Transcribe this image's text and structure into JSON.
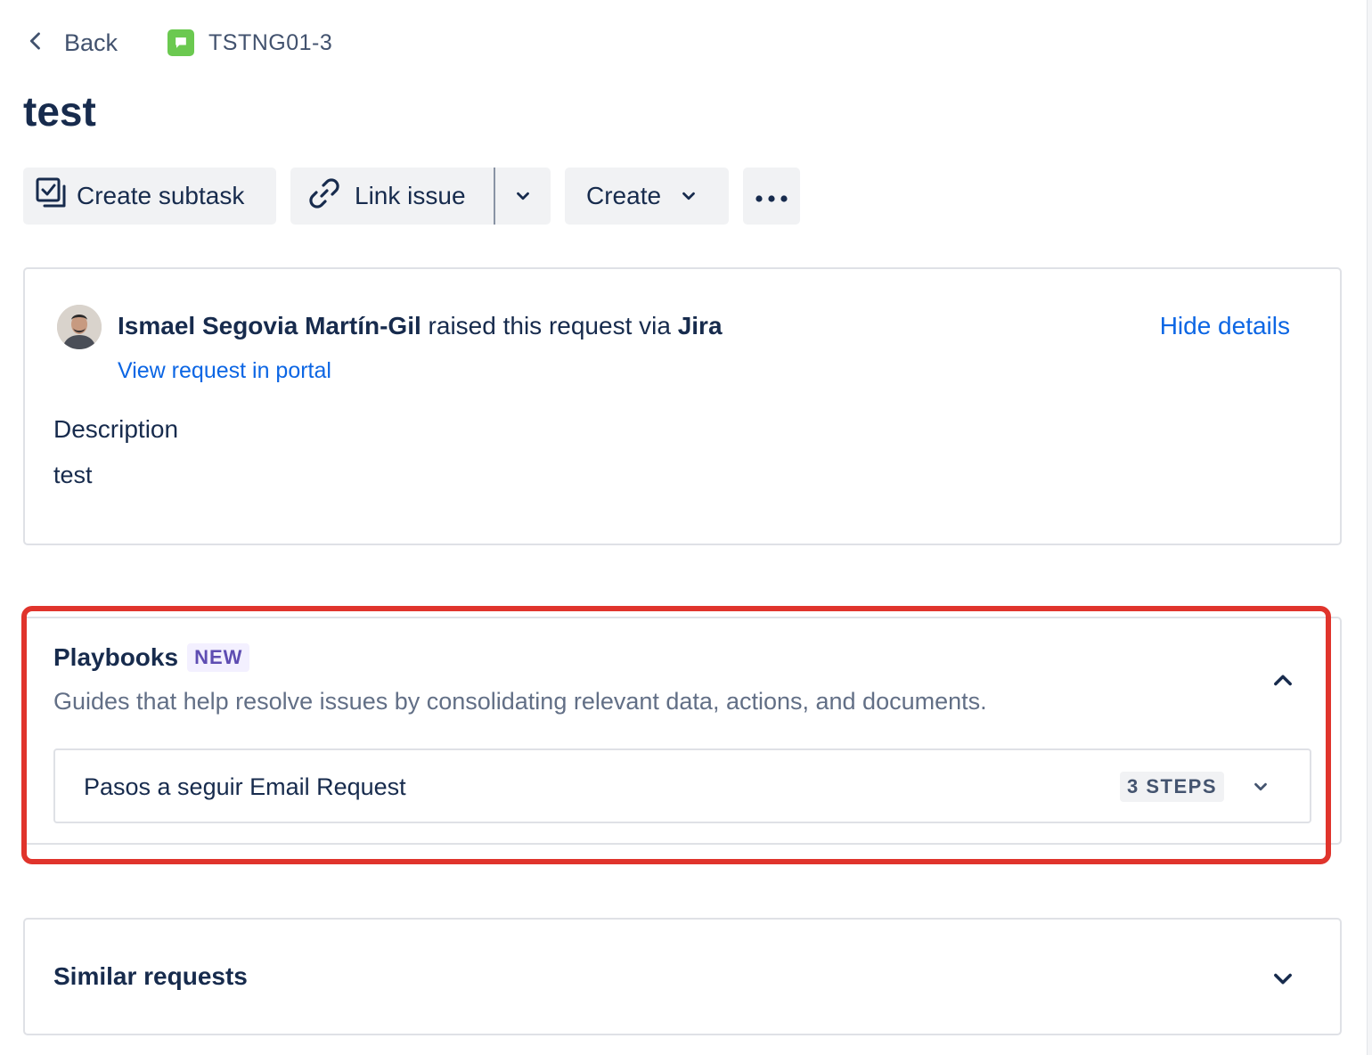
{
  "header": {
    "back_label": "Back",
    "issue_key": "TSTNG01-3",
    "issue_type_icon": "speech-bubble-icon",
    "issue_type_color": "#6bc950"
  },
  "title": "test",
  "toolbar": {
    "create_subtask_label": "Create subtask",
    "link_issue_label": "Link issue",
    "create_label": "Create"
  },
  "details": {
    "reporter": "Ismael Segovia Martín-Gil",
    "raised_text": " raised this request via ",
    "channel": "Jira",
    "view_portal_label": "View request in portal",
    "hide_details_label": "Hide details",
    "description_heading": "Description",
    "description_text": "test"
  },
  "playbooks": {
    "title": "Playbooks",
    "badge": "NEW",
    "subtitle": "Guides that help resolve issues by consolidating relevant data, actions, and documents.",
    "items": [
      {
        "name": "Pasos a seguir Email Request",
        "steps": "3 STEPS"
      }
    ],
    "highlight_color": "#e0342c"
  },
  "similar": {
    "title": "Similar requests"
  },
  "colors": {
    "link": "#0c66e4",
    "text": "#172b4d",
    "button_bg": "#f1f2f4"
  }
}
